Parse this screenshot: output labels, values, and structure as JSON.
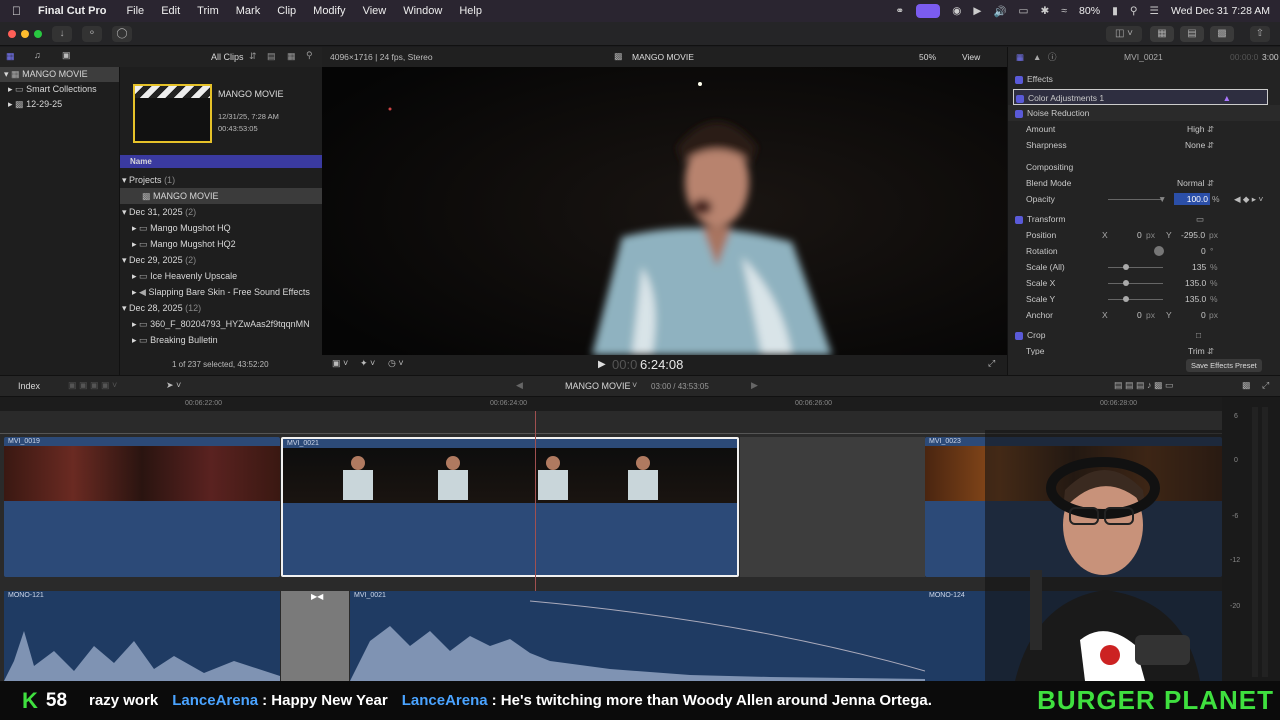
{
  "menubar": {
    "app": "Final Cut Pro",
    "items": [
      "File",
      "Edit",
      "Trim",
      "Mark",
      "Clip",
      "Modify",
      "View",
      "Window",
      "Help"
    ],
    "battery": "80%",
    "datetime": "Wed Dec 31  7:28 AM"
  },
  "library": {
    "root": "MANGO MOVIE",
    "items": [
      "Smart Collections",
      "12-29-25"
    ]
  },
  "browser": {
    "filter": "All Clips",
    "project_title": "MANGO MOVIE",
    "project_date": "12/31/25, 7:28 AM",
    "project_duration": "00:43:53:05",
    "column_header": "Name",
    "groups": [
      {
        "label": "Projects",
        "count": "(1)",
        "items": [
          "MANGO MOVIE"
        ]
      },
      {
        "label": "Dec 31, 2025",
        "count": "(2)",
        "items": [
          "Mango Mugshot HQ",
          "Mango Mugshot HQ2"
        ]
      },
      {
        "label": "Dec 29, 2025",
        "count": "(2)",
        "items": [
          "Ice Heavenly Upscale",
          "Slapping Bare Skin - Free Sound Effects"
        ]
      },
      {
        "label": "Dec 28, 2025",
        "count": "(12)",
        "items": [
          "360_F_80204793_HYZwAas2f9tqqnMN",
          "Breaking Bulletin"
        ]
      }
    ],
    "selection": "1 of 237 selected, 43:52:20"
  },
  "viewer": {
    "format": "4096×1716 | 24 fps, Stereo",
    "title": "MANGO MOVIE",
    "zoom": "50%",
    "view": "View",
    "timecode": "6:24:08",
    "timecode_dim": "00:0"
  },
  "inspector": {
    "clip": "MVI_0021",
    "duration": "3:00",
    "duration_dim": "00:00:0",
    "effects_header": "Effects",
    "color_adj": "Color Adjustments 1",
    "noise": "Noise Reduction",
    "amount_label": "Amount",
    "amount_value": "High",
    "sharp_label": "Sharpness",
    "sharp_value": "None",
    "compositing": "Compositing",
    "blend_label": "Blend Mode",
    "blend_value": "Normal",
    "opacity_label": "Opacity",
    "opacity_value": "100.0",
    "opacity_unit": "%",
    "transform": "Transform",
    "pos_label": "Position",
    "pos_x": "0",
    "pos_y": "-295.0",
    "px": "px",
    "rot_label": "Rotation",
    "rot_value": "0",
    "deg": "°",
    "scale_all_label": "Scale (All)",
    "scale_all": "135",
    "scale_x_label": "Scale X",
    "scale_x": "135.0",
    "scale_y_label": "Scale Y",
    "scale_y": "135.0",
    "anchor_label": "Anchor",
    "anchor_x": "0",
    "anchor_y": "0",
    "crop": "Crop",
    "type_label": "Type",
    "type_value": "Trim",
    "save_preset": "Save Effects Preset",
    "x": "X",
    "y": "Y",
    "pct": "%"
  },
  "timeline": {
    "index": "Index",
    "project": "MANGO MOVIE",
    "position": "03:00 / 43:53:05",
    "ruler": [
      "00:06:22:00",
      "00:06:24:00",
      "00:06:26:00",
      "00:06:28:00"
    ],
    "clips": [
      "MVI_0019",
      "MVI_0021",
      "MVI_0023"
    ],
    "audio": [
      "MONO-121",
      "MVI_0021",
      "MONO-124"
    ],
    "meter": [
      "6",
      "0",
      "-6",
      "-12",
      "-20"
    ]
  },
  "ticker": {
    "k_label": "K",
    "count": "58",
    "msg0": "razy work",
    "user1": "LanceArena",
    "msg1": ": Happy New Year",
    "user2": "LanceArena",
    "msg2": ": He's twitching more than Woody Allen around Jenna Ortega.",
    "brand": "BURGER PLANET"
  },
  "colors": {
    "accent": "#5a5ad8",
    "selection": "#3a3aa0",
    "ticker_user": "#4aa3ff",
    "brand": "#3fe03f"
  }
}
